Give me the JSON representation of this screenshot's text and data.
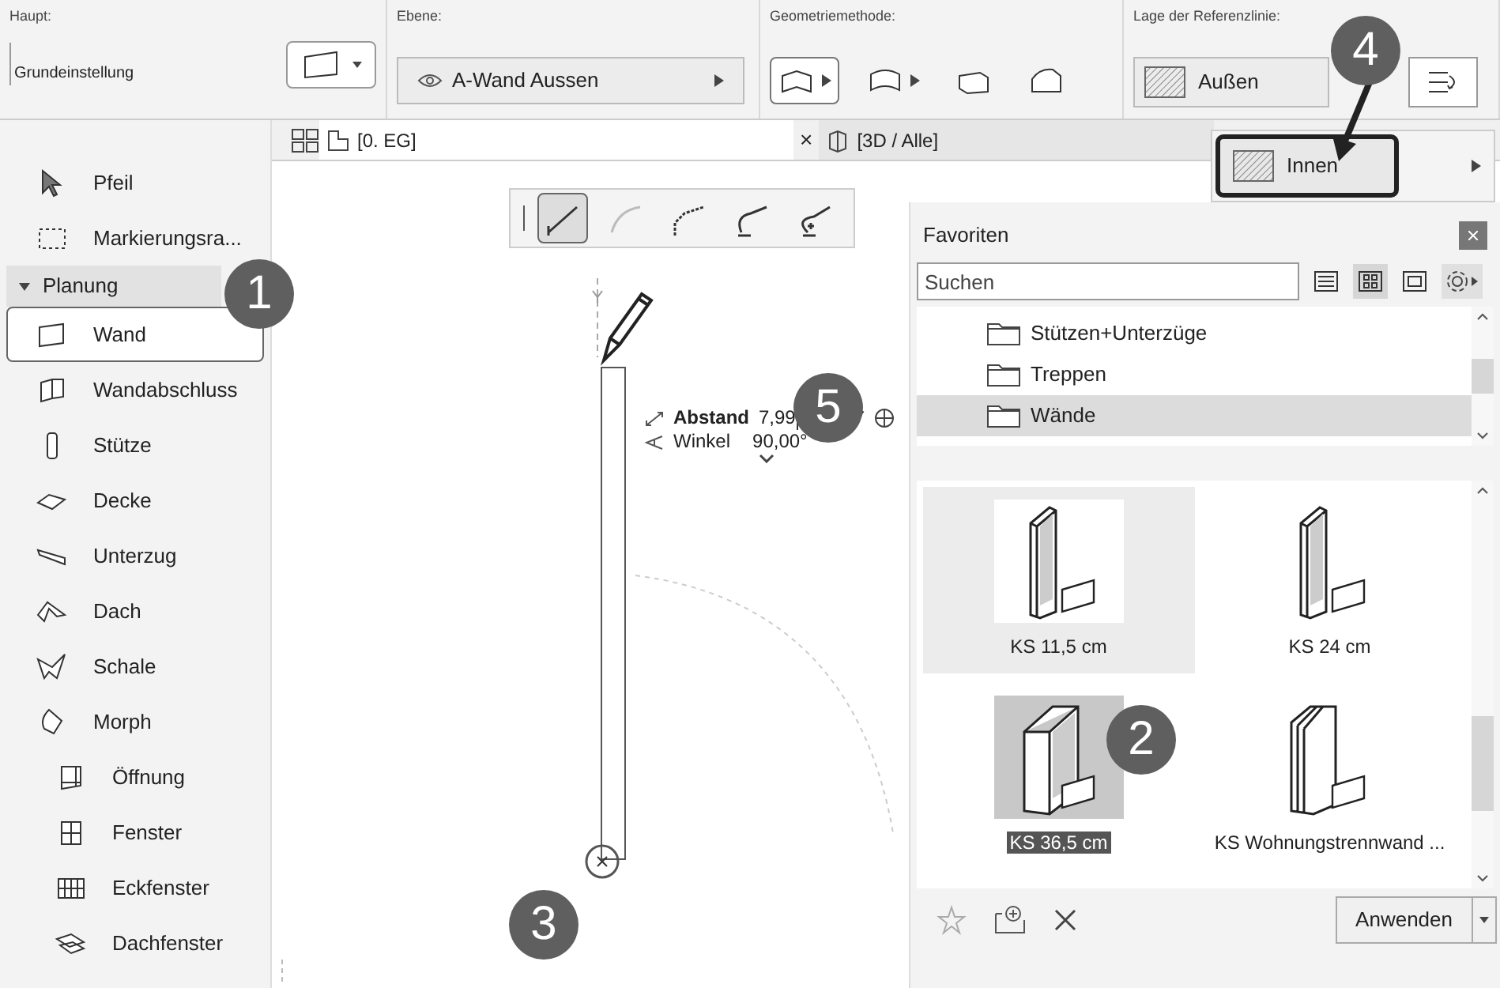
{
  "toolbar": [
    {
      "label": "Haupt:",
      "value": "Grundeinstellung"
    },
    {
      "label": "Ebene:",
      "value": "A-Wand Aussen"
    },
    {
      "label": "Geometriemethode:"
    },
    {
      "label": "Lage der Referenzlinie:",
      "value": "Außen"
    }
  ],
  "geometry_methods": [
    {
      "selected": true
    },
    {
      "selected": false
    },
    {
      "selected": false
    },
    {
      "selected": false
    }
  ],
  "tabs": [
    {
      "label": "[0. EG]",
      "selected": true
    },
    {
      "label": "[3D / Alle]",
      "selected": false
    }
  ],
  "tab_close": "×",
  "reference_menu": {
    "option": "Innen"
  },
  "sidebar": {
    "items": [
      {
        "kind": "tool",
        "label": "Pfeil",
        "selected": false
      },
      {
        "kind": "tool",
        "label": "Markierungsra...",
        "selected": false
      },
      {
        "kind": "group",
        "label": "Planung",
        "expanded": true
      },
      {
        "kind": "tool",
        "label": "Wand",
        "selected": true
      },
      {
        "kind": "tool",
        "label": "Wandabschluss",
        "selected": false
      },
      {
        "kind": "tool",
        "label": "Stütze",
        "selected": false
      },
      {
        "kind": "tool",
        "label": "Decke",
        "selected": false
      },
      {
        "kind": "tool",
        "label": "Unterzug",
        "selected": false
      },
      {
        "kind": "tool",
        "label": "Dach",
        "selected": false
      },
      {
        "kind": "tool",
        "label": "Schale",
        "selected": false
      },
      {
        "kind": "tool",
        "label": "Morph",
        "selected": false
      },
      {
        "kind": "tool",
        "label": "Öffnung",
        "selected": false
      },
      {
        "kind": "tool",
        "label": "Fenster",
        "selected": false
      },
      {
        "kind": "tool",
        "label": "Eckfenster",
        "selected": false
      },
      {
        "kind": "tool",
        "label": "Dachfenster",
        "selected": false
      }
    ]
  },
  "draw_modes": [
    {
      "selected": true
    },
    {
      "selected": false
    },
    {
      "selected": false
    },
    {
      "selected": false
    },
    {
      "selected": false
    }
  ],
  "tracker": {
    "distance_label": "Abstand",
    "distance_value": "7,99",
    "angle_label": "Winkel",
    "angle_value": "90,00°"
  },
  "favorites": {
    "title": "Favoriten",
    "search_placeholder": "Suchen",
    "view_modes": [
      {
        "selected": false
      },
      {
        "selected": true
      },
      {
        "selected": false
      }
    ],
    "folders": [
      {
        "label": "Stützen+Unterzüge",
        "selected": false
      },
      {
        "label": "Treppen",
        "selected": false
      },
      {
        "label": "Wände",
        "selected": true
      }
    ],
    "items": [
      {
        "label": "KS 11,5 cm",
        "selected": false,
        "hovered": true
      },
      {
        "label": "KS 24 cm",
        "selected": false,
        "hovered": false
      },
      {
        "label": "KS 36,5 cm",
        "selected": true,
        "hovered": false
      },
      {
        "label": "KS Wohnungstrennwand ...",
        "selected": false,
        "hovered": false
      }
    ],
    "apply": "Anwenden"
  },
  "callouts": [
    "1",
    "2",
    "3",
    "4",
    "5"
  ]
}
